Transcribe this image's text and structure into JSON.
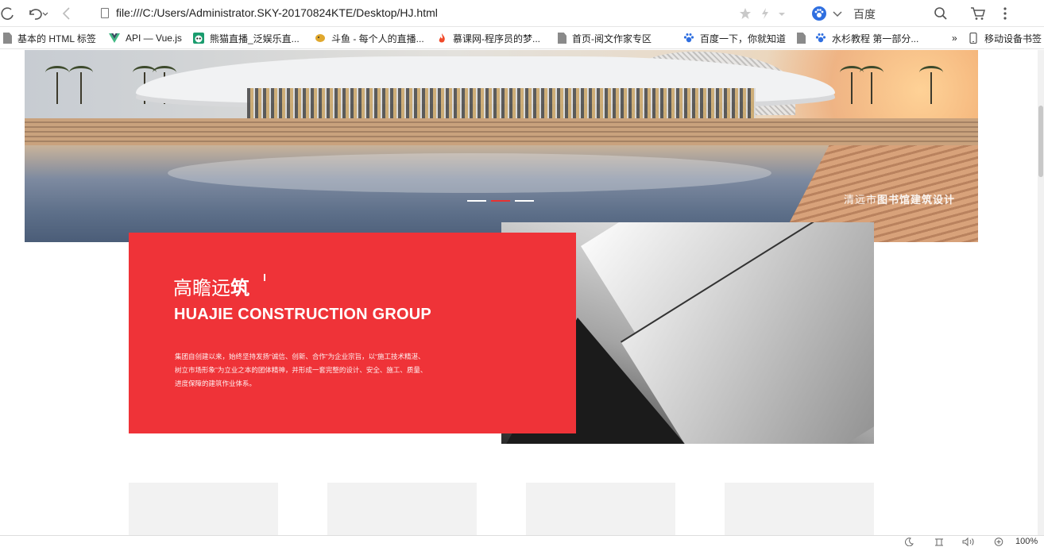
{
  "browser": {
    "url": "file:///C:/Users/Administrator.SKY-20170824KTE/Desktop/HJ.html",
    "search_engine": "百度",
    "zoom": "100%",
    "bookmarks": [
      {
        "label": "基本的 HTML 标签",
        "icon": "document-icon"
      },
      {
        "label": "API — Vue.js",
        "icon": "vue-icon"
      },
      {
        "label": "熊猫直播_泛娱乐直...",
        "icon": "panda-icon"
      },
      {
        "label": "斗鱼 - 每个人的直播...",
        "icon": "douyu-icon"
      },
      {
        "label": "慕课网-程序员的梦...",
        "icon": "flame-icon"
      },
      {
        "label": "首页-阅文作家专区",
        "icon": "document-icon"
      },
      {
        "label": "百度一下，你就知道",
        "icon": "baidu-paw-icon"
      },
      {
        "label": "水杉教程 第一部分...",
        "icon": "baidu-paw-icon"
      }
    ],
    "more_bookmarks": "»",
    "mobile_bookmarks": "移动设备书签"
  },
  "banner": {
    "caption_prefix": "清远市",
    "caption_bold": "图书馆建筑设计",
    "slides": 3,
    "active_slide": 2
  },
  "intro": {
    "title_light": "高瞻远",
    "title_bold": "筑",
    "subtitle": "HUAJIE CONSTRUCTION GROUP",
    "description": "集团自创建以来，始终坚持发扬“诚信、创新、合作”为企业宗旨，以“施工技术精湛、树立市场形象”为立业之本的团体精神，并形成一套完整的设计、安全、施工、质量、进度保障的建筑作业体系。"
  },
  "features": [
    {},
    {},
    {},
    {}
  ],
  "colors": {
    "accent_red": "#ef3338",
    "dot_active": "#e83232",
    "placeholder_gray": "#f2f2f2"
  }
}
